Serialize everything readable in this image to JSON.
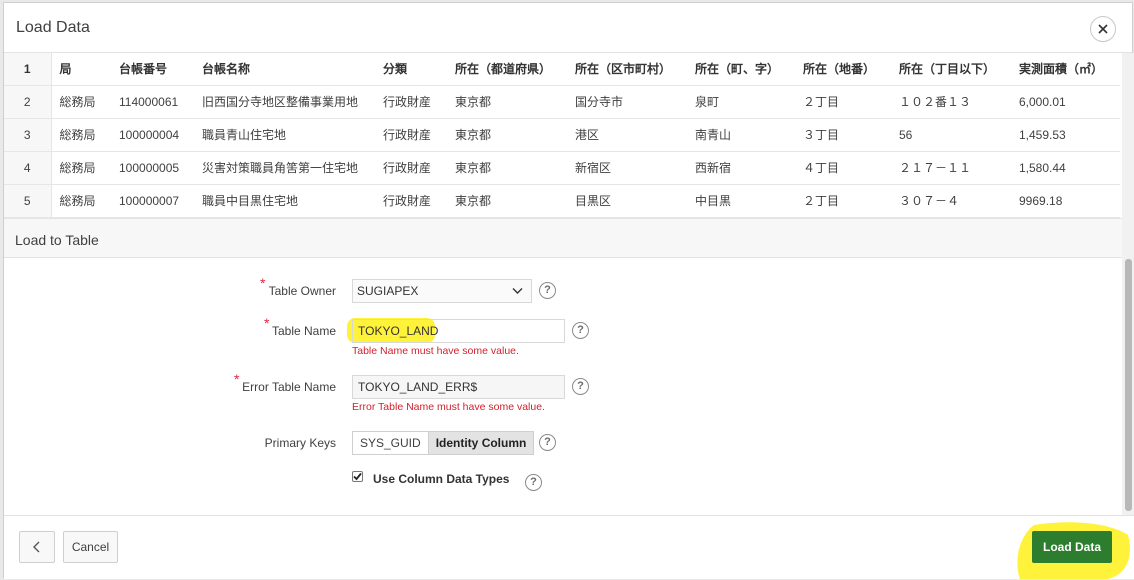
{
  "dialog": {
    "title": "Load Data"
  },
  "grid": {
    "headers": [
      "1",
      "局",
      "台帳番号",
      "台帳名称",
      "分類",
      "所在（都道府県）",
      "所在（区市町村）",
      "所在（町、字）",
      "所在（地番）",
      "所在（丁目以下）",
      "実測面積（㎡）"
    ],
    "rows": [
      [
        "2",
        "総務局",
        "114000061",
        "旧西国分寺地区整備事業用地",
        "行政財産",
        "東京都",
        "国分寺市",
        "泉町",
        "２丁目",
        "１０２番１３",
        "6,000.01"
      ],
      [
        "3",
        "総務局",
        "100000004",
        "職員青山住宅地",
        "行政財産",
        "東京都",
        "港区",
        "南青山",
        "３丁目",
        "56",
        "1,459.53"
      ],
      [
        "4",
        "総務局",
        "100000005",
        "災害対策職員角筈第一住宅地",
        "行政財産",
        "東京都",
        "新宿区",
        "西新宿",
        "４丁目",
        "２１７－１１",
        "1,580.44"
      ],
      [
        "5",
        "総務局",
        "100000007",
        "職員中目黒住宅地",
        "行政財産",
        "東京都",
        "目黒区",
        "中目黒",
        "２丁目",
        "３０７－４",
        "9969.18"
      ]
    ]
  },
  "section": {
    "title": "Load to Table"
  },
  "form": {
    "required_mark": "*",
    "help_glyph": "?",
    "table_owner_label": "Table Owner",
    "table_owner_value": "SUGIAPEX",
    "table_name_label": "Table Name",
    "table_name_value": "TOKYO_LAND",
    "table_name_error": "Table Name must have some value.",
    "error_table_label": "Error Table Name",
    "error_table_value": "TOKYO_LAND_ERR$",
    "error_table_error": "Error Table Name must have some value.",
    "primary_keys_label": "Primary Keys",
    "primary_keys_options": [
      "SYS_GUID",
      "Identity Column"
    ],
    "primary_keys_selected": "Identity Column",
    "use_column_types_label": "Use Column Data Types",
    "use_column_types_checked": true
  },
  "footer": {
    "back_glyph": "<",
    "cancel_label": "Cancel",
    "load_label": "Load Data"
  },
  "colors": {
    "highlight": "#fff23a",
    "primary_button": "#2c7d2e",
    "error_text": "#d0212d",
    "required": "#e5243b"
  },
  "icons": {
    "close": "close-icon",
    "select_arrow": "chevron-down-icon",
    "help": "help-icon",
    "checkbox": "checkmark-icon",
    "back": "chevron-left-icon"
  }
}
